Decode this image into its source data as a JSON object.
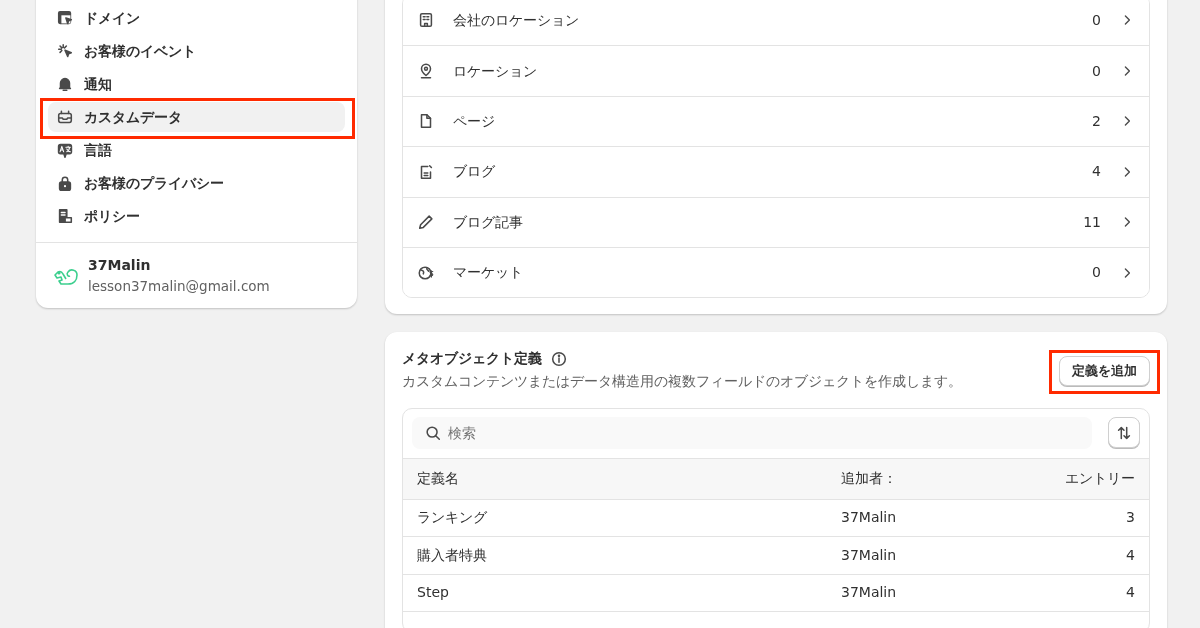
{
  "sidebar": {
    "items": [
      {
        "label": "ドメイン",
        "selected": false,
        "annotated": false
      },
      {
        "label": "お客様のイベント",
        "selected": false,
        "annotated": false
      },
      {
        "label": "通知",
        "selected": false,
        "annotated": false
      },
      {
        "label": "カスタムデータ",
        "selected": true,
        "annotated": true
      },
      {
        "label": "言語",
        "selected": false,
        "annotated": false
      },
      {
        "label": "お客様のプライバシー",
        "selected": false,
        "annotated": false
      },
      {
        "label": "ポリシー",
        "selected": false,
        "annotated": false
      }
    ],
    "account": {
      "name": "37Malin",
      "email": "lesson37malin@gmail.com"
    }
  },
  "metafields": {
    "rows": [
      {
        "label": "会社のロケーション",
        "count": "0"
      },
      {
        "label": "ロケーション",
        "count": "0"
      },
      {
        "label": "ページ",
        "count": "2"
      },
      {
        "label": "ブログ",
        "count": "4"
      },
      {
        "label": "ブログ記事",
        "count": "11"
      },
      {
        "label": "マーケット",
        "count": "0"
      }
    ]
  },
  "metaobjects": {
    "title": "メタオブジェクト定義",
    "description": "カスタムコンテンツまたはデータ構造用の複数フィールドのオブジェクトを作成します。",
    "add_button": {
      "label": "定義を追加",
      "annotated": true
    },
    "search": {
      "placeholder": "検索"
    },
    "table": {
      "columns": [
        "定義名",
        "追加者：",
        "エントリー"
      ],
      "rows": [
        [
          "ランキング",
          "37Malin",
          "3"
        ],
        [
          "購入者特典",
          "37Malin",
          "4"
        ],
        [
          "Step",
          "37Malin",
          "4"
        ]
      ]
    }
  }
}
